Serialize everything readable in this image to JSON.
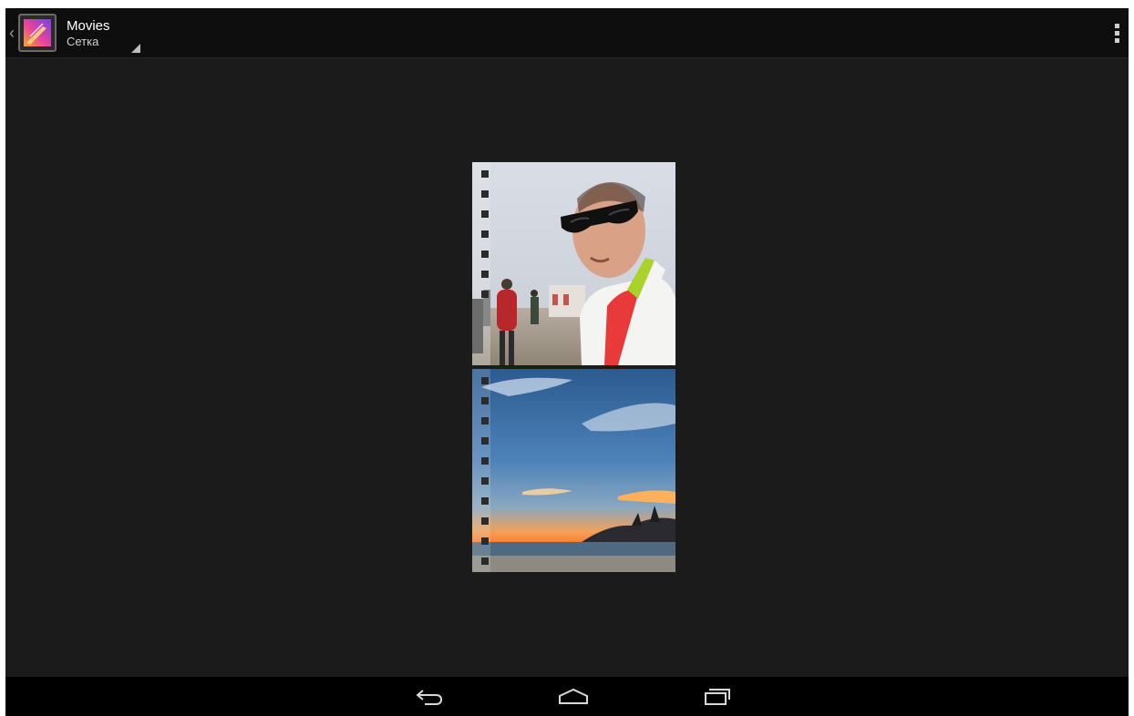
{
  "action_bar": {
    "title": "Movies",
    "subtitle": "Сетка",
    "up_icon": "chevron-left-icon",
    "app_icon": "gallery-icon",
    "overflow_icon": "overflow-menu-icon"
  },
  "grid": {
    "items": [
      {
        "kind": "video",
        "thumb": "selfie-man-sunglasses",
        "icon": "film-strip-icon"
      },
      {
        "kind": "video",
        "thumb": "sunset-beach",
        "icon": "film-strip-icon"
      }
    ]
  },
  "navigation_bar": {
    "back_icon": "back-icon",
    "home_icon": "home-icon",
    "recents_icon": "recent-apps-icon"
  },
  "colors": {
    "background": "#1b1b1b",
    "action_bar": "#0e0e0e",
    "nav_bar": "#000000",
    "text_primary": "#ffffff"
  }
}
